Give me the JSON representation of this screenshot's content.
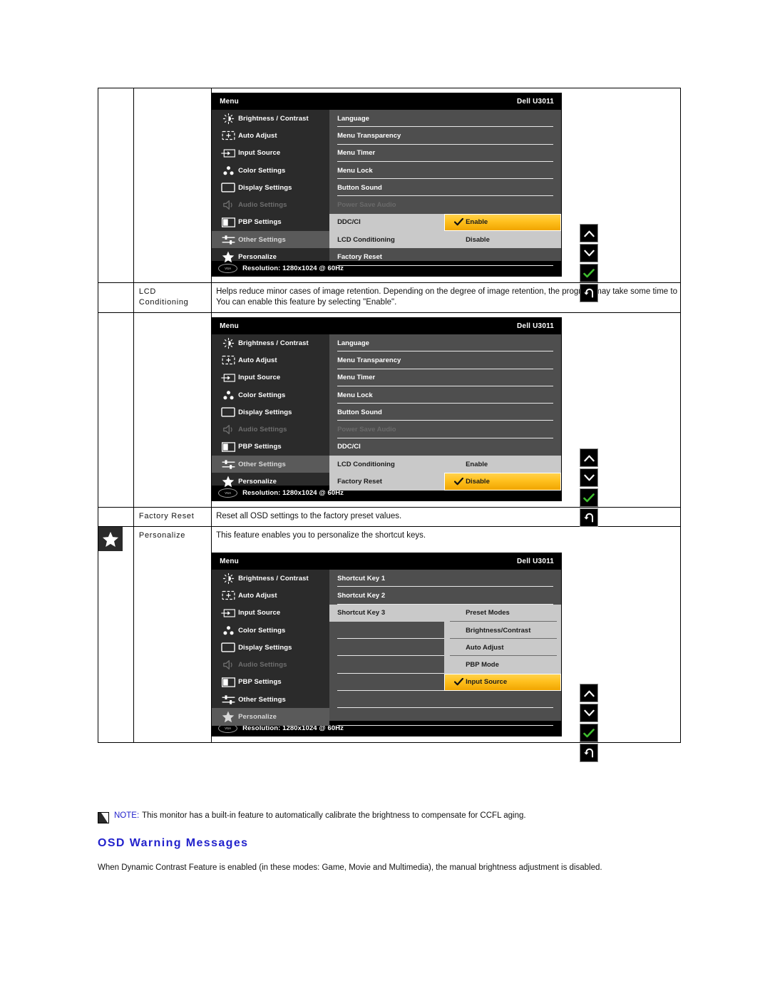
{
  "page": {
    "heading": "OSD Warning Messages",
    "paragraph": "When Dynamic Contrast Feature is enabled (in these modes: Game, Movie and Multimedia), the manual brightness adjustment is disabled.",
    "note_label": "NOTE:",
    "note_text": "This monitor has a built-in feature to automatically calibrate the brightness to compensate for CCFL aging."
  },
  "rows": {
    "lcd_conditioning": {
      "name": "LCD Conditioning",
      "desc_line1": "Helps reduce minor cases of image retention. Depending on the degree of image retention, the program may take some time to",
      "desc_line2": "You can enable this feature by selecting \"Enable\"."
    },
    "factory_reset": {
      "name": "Factory Reset",
      "desc": "Reset all OSD settings to the factory preset values."
    },
    "personalize": {
      "name": "Personalize",
      "desc": "This feature enables you to personalize the shortcut keys.",
      "icon": "star-icon"
    }
  },
  "osd": {
    "title_left": "Menu",
    "title_right": "Dell U3011",
    "resolution": "Resolution: 1280x1024 @ 60Hz",
    "vga_label": "VGA",
    "nav": [
      {
        "label": "Brightness / Contrast",
        "icon": "brightness-icon"
      },
      {
        "label": "Auto Adjust",
        "icon": "auto-adjust-icon"
      },
      {
        "label": "Input Source",
        "icon": "input-source-icon"
      },
      {
        "label": "Color Settings",
        "icon": "color-settings-icon"
      },
      {
        "label": "Display Settings",
        "icon": "display-settings-icon"
      },
      {
        "label": "Audio Settings",
        "icon": "audio-settings-icon"
      },
      {
        "label": "PBP Settings",
        "icon": "pbp-settings-icon"
      },
      {
        "label": "Other Settings",
        "icon": "other-settings-icon"
      },
      {
        "label": "Personalize",
        "icon": "personalize-icon"
      }
    ],
    "other_settings_items": [
      "Language",
      "Menu Transparency",
      "Menu Timer",
      "Menu Lock",
      "Button Sound",
      "Power Save Audio",
      "DDC/CI",
      "LCD Conditioning",
      "Factory Reset"
    ],
    "personalize_items": [
      "Shortcut Key 1",
      "Shortcut Key 2",
      "Shortcut Key 3"
    ],
    "toggle_options": [
      "Enable",
      "Disable"
    ],
    "shortcut_options": [
      "Preset Modes",
      "Brightness/Contrast",
      "Auto Adjust",
      "PBP Mode",
      "Input Source"
    ],
    "buttons": [
      {
        "icon": "chevron-up-icon"
      },
      {
        "icon": "chevron-down-icon"
      },
      {
        "icon": "check-icon"
      },
      {
        "icon": "back-arrow-icon"
      }
    ],
    "panel_a": {
      "active_item": "DDC/CI",
      "selected_option": "Enable"
    },
    "panel_b": {
      "active_item": "LCD Conditioning",
      "selected_option": "Disable"
    },
    "panel_c": {
      "active_item": "Shortcut Key 3",
      "selected_option": "Input Source"
    }
  },
  "colors": {
    "highlight": "#ffc01e",
    "panel_dark": "#2b2b2b",
    "panel_mid": "#4e4e4e",
    "submenu": "#c9c9c9",
    "link_blue": "#2222cc",
    "check_green": "#3fbf2f"
  }
}
